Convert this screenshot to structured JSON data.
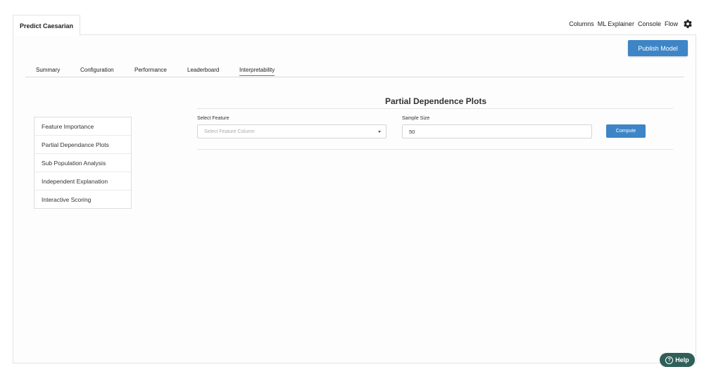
{
  "project_tab": {
    "label": "Predict Caesarian"
  },
  "top_nav": {
    "columns": "Columns",
    "ml_explainer": "ML Explainer",
    "console": "Console",
    "flow": "Flow",
    "settings_icon": "gear-icon"
  },
  "publish_button": {
    "label": "Publish Model"
  },
  "tabs": [
    {
      "label": "Summary",
      "active": false
    },
    {
      "label": "Configuration",
      "active": false
    },
    {
      "label": "Performance",
      "active": false
    },
    {
      "label": "Leaderboard",
      "active": false
    },
    {
      "label": "Interpretability",
      "active": true
    }
  ],
  "section_title": "Partial Dependence Plots",
  "side_menu": {
    "items": [
      "Feature Importance",
      "Partial Dependance Plots",
      "Sub Population Analysis",
      "Independent Explanation",
      "Interactive Scoring"
    ]
  },
  "form": {
    "feature_label": "Select Feature",
    "feature_placeholder": "Select Feature Column",
    "sample_label": "Sample Size",
    "sample_value": "50",
    "compute_label": "Compute"
  },
  "help": {
    "label": "Help",
    "icon_glyph": "?"
  },
  "colors": {
    "accent": "#3d85c6",
    "help_bg": "#2f5f59"
  }
}
